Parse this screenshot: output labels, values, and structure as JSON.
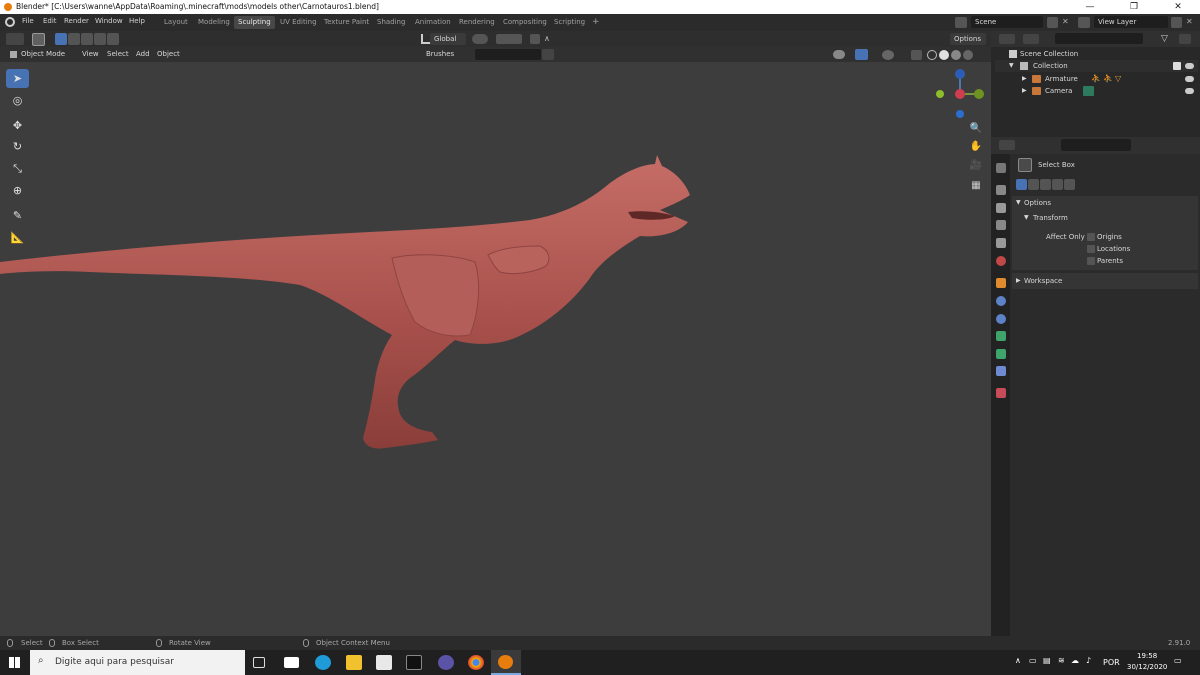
{
  "window": {
    "title": "Blender* [C:\\Users\\wanne\\AppData\\Roaming\\.minecraft\\mods\\models other\\Carnotauros1.blend]",
    "minimize": "—",
    "maximize": "❐",
    "close": "✕"
  },
  "menubar": {
    "items": [
      "File",
      "Edit",
      "Render",
      "Window",
      "Help"
    ]
  },
  "workspace_tabs": [
    "Layout",
    "Modeling",
    "Sculpting",
    "UV Editing",
    "Texture Paint",
    "Shading",
    "Animation",
    "Rendering",
    "Compositing",
    "Scripting"
  ],
  "active_tab": "Sculpting",
  "add_tab": "+",
  "scene": {
    "label": "Scene",
    "view_layer": "View Layer"
  },
  "viewport_header": {
    "mode": "Object Mode",
    "menus": [
      "View",
      "Select",
      "Add",
      "Object"
    ],
    "orientation": "Global",
    "brushes": "Brushes",
    "options": "Options"
  },
  "outliner": {
    "title": "Scene Collection",
    "items": [
      {
        "label": "Collection"
      },
      {
        "label": "Armature"
      },
      {
        "label": "Camera"
      }
    ]
  },
  "properties": {
    "tool_name": "Select Box",
    "options_label": "Options",
    "transform_label": "Transform",
    "affect_only": "Affect Only",
    "checkboxes": [
      "Origins",
      "Locations",
      "Parents"
    ],
    "workspace_label": "Workspace"
  },
  "statusbar": {
    "select": "Select",
    "box_select": "Box Select",
    "rotate_view": "Rotate View",
    "context_menu": "Object Context Menu",
    "version": "2.91.0"
  },
  "taskbar": {
    "search_placeholder": "Digite aqui para pesquisar",
    "language": "POR",
    "time": "19:58",
    "date": "30/12/2020"
  },
  "colors": {
    "accent": "#4772b3",
    "model": "#b05a55",
    "viewport_bg": "#3d3d3d"
  }
}
